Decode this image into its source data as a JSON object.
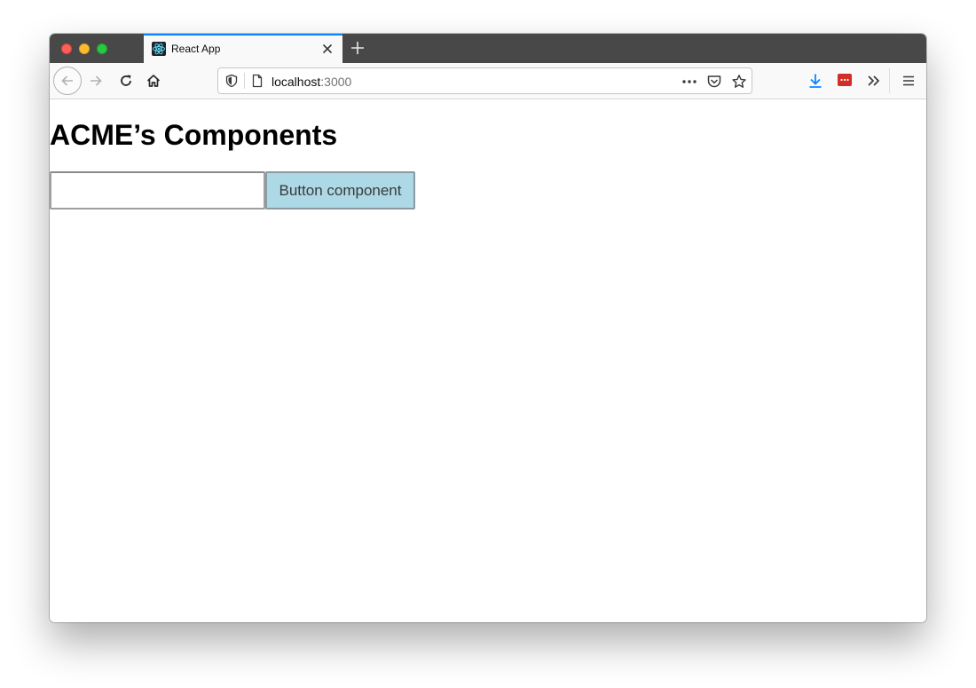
{
  "browser": {
    "tab": {
      "title": "React App",
      "favicon": "react-logo-icon"
    },
    "url": {
      "host": "localhost",
      "port": ":3000"
    },
    "colors": {
      "tab_accent": "#0a84ff",
      "download_icon": "#0a84ff",
      "lastpass_icon": "#d32d27"
    }
  },
  "page": {
    "title": "ACME’s Components",
    "input": {
      "value": "",
      "placeholder": ""
    },
    "button": {
      "label": "Button component",
      "background": "#add8e6"
    }
  }
}
